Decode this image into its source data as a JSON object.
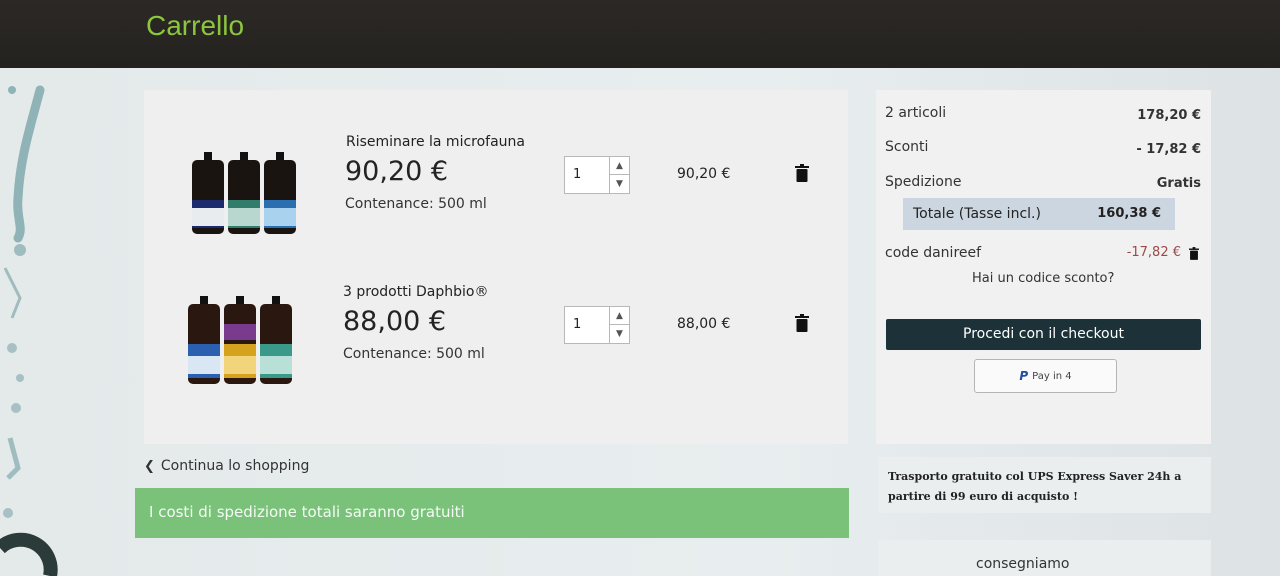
{
  "header": {
    "title": "Carrello"
  },
  "cart": {
    "items": [
      {
        "name": "Riseminare la microfauna",
        "price": "90,20 €",
        "capacity": "Contenance: 500 ml",
        "qty": "1",
        "line_total": "90,20 €",
        "bottle_colors": [
          "#1b2b6e",
          "#2f7d6a",
          "#2b6fb0"
        ]
      },
      {
        "name": "3 prodotti Daphbio®",
        "price": "88,00 €",
        "capacity": "Contenance: 500 ml",
        "qty": "1",
        "line_total": "88,00 €",
        "bottle_colors": [
          "#2b5fb0",
          "#d6a21e",
          "#3a9a8a"
        ]
      }
    ],
    "continue_label": "Continua lo shopping",
    "free_shipping_banner": "I costi di spedizione totali saranno gratuiti"
  },
  "summary": {
    "items_label": "2 articoli",
    "items_value": "178,20 €",
    "discount_label": "Sconti",
    "discount_value": "- 17,82 €",
    "shipping_label": "Spedizione",
    "shipping_value": "Gratis",
    "total_label": "Totale (Tasse incl.)",
    "total_value": "160,38 €",
    "voucher_label": "code danireef",
    "voucher_value": "-17,82 €",
    "promo_link": "Hai un codice sconto?",
    "checkout_label": "Procedi con il checkout",
    "paypal_label": "Pay in 4",
    "paypal_logo": "P"
  },
  "shipping_info": {
    "text": "Trasporto gratuito col UPS Express Saver 24h a partire di 99 euro di acquisto !"
  },
  "delivery": {
    "text": "consegniamo"
  },
  "colors": {
    "header_green": "#8cc63f",
    "checkout_bg": "#1c3138",
    "banner_green": "#7ac27a",
    "total_bg": "#ccd6e0"
  }
}
